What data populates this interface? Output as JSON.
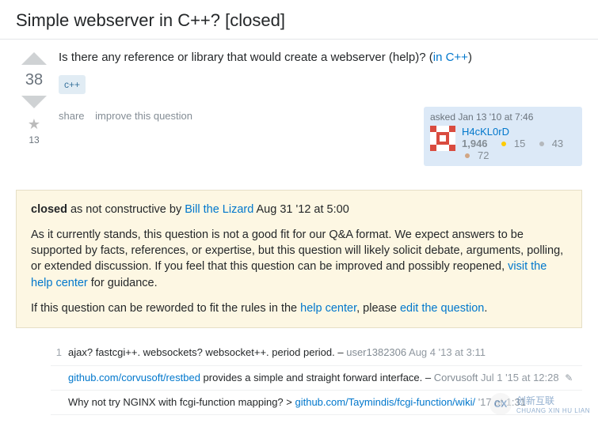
{
  "header": {
    "title": "Simple webserver in C++? [closed]"
  },
  "question": {
    "body_prefix": "Is there any reference or library that would create a webserver (help)? (",
    "body_link": "in C++",
    "body_suffix": ")",
    "tags": [
      "c++"
    ],
    "vote_count": "38",
    "favorite_count": "13",
    "menu": {
      "share": "share",
      "improve": "improve this question"
    },
    "signature": {
      "action": "asked Jan 13 '10 at 7:46",
      "user": "H4cKL0rD",
      "reputation": "1,946",
      "gold": "15",
      "silver": "43",
      "bronze": "72"
    }
  },
  "closed": {
    "label": "closed",
    "reason_text": " as not constructive by ",
    "closer": "Bill the Lizard",
    "when": " Aug 31 '12 at 5:00",
    "p1a": "As it currently stands, this question is not a good fit for our Q&A format. We expect answers to be supported by facts, references, or expertise, but this question will likely solicit debate, arguments, polling, or extended discussion. If you feel that this question can be improved and possibly reopened, ",
    "p1_link": "visit the help center",
    "p1b": " for guidance.",
    "p2a": "If this question can be reworded to fit the rules in the ",
    "p2_link1": "help center",
    "p2b": ", please ",
    "p2_link2": "edit the question",
    "p2c": "."
  },
  "comments": [
    {
      "score": "1",
      "text": "ajax? fastcgi++. websockets? websocket++. period period. – ",
      "user": "user1382306",
      "user_link": false,
      "date": "Aug 4 '13 at 3:11",
      "links": []
    },
    {
      "score": "",
      "text_parts": [
        "",
        " provides a simple and straight forward interface. – "
      ],
      "links": [
        "github.com/corvusoft/restbed"
      ],
      "user": "Corvusoft",
      "user_link": true,
      "date": "Jul 1 '15 at 12:28",
      "edited": true
    },
    {
      "score": "",
      "text_parts": [
        "Why not try NGINX with fcgi-function mapping? > ",
        "  '17 at 1:31"
      ],
      "links": [
        "github.com/Taymindis/fcgi-function/wiki/"
      ],
      "user": "",
      "user_link": false,
      "date": ""
    }
  ],
  "watermark": {
    "logo": "CX",
    "line1": "创新互联",
    "line2": "CHUANG XIN HU LIAN"
  }
}
